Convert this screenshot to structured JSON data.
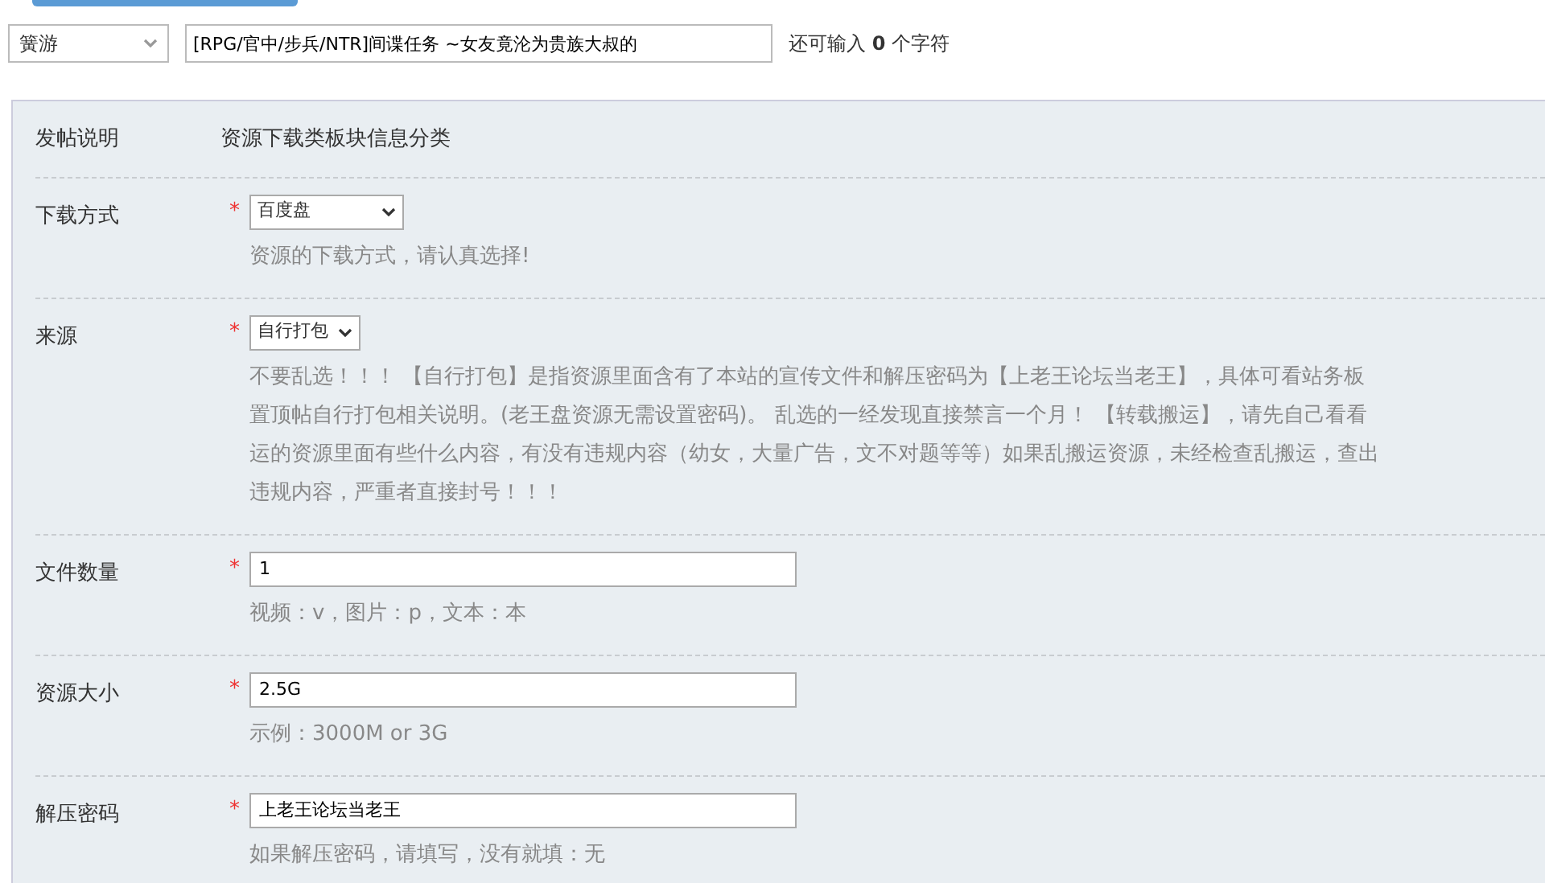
{
  "header": {
    "category_select": {
      "value": "簧游"
    },
    "title_input": {
      "value": "[RPG/官中/步兵/NTR]间谍任务 ~女友竟沦为贵族大叔的"
    },
    "char_counter": "还可输入 **0** 个字符"
  },
  "rows": [
    {
      "kind": "text",
      "label": "发帖说明",
      "value": "资源下载类板块信息分类"
    },
    {
      "kind": "select",
      "label": "下载方式",
      "required_mark": "*",
      "value": "百度盘",
      "hint_lines": [
        "资源的下载方式，请认真选择!"
      ]
    },
    {
      "kind": "select",
      "label": "来源",
      "required_mark": "*",
      "value": "自行打包",
      "hint_lines": [
        "不要乱选！！！ 【自行打包】是指资源里面含有了本站的宣传文件和解压密码为【上老王论坛当老王】，具体可看站务板",
        "置顶帖自行打包相关说明。(老王盘资源无需设置密码)。 乱选的一经发现直接禁言一个月！ 【转载搬运】，请先自己看看",
        "运的资源里面有些什么内容，有没有违规内容（幼女，大量广告，文不对题等等）如果乱搬运资源，未经检查乱搬运，查出",
        "违规内容，严重者直接封号！！！"
      ]
    },
    {
      "kind": "input",
      "label": "文件数量",
      "required_mark": "*",
      "value": "1",
      "hint_lines": [
        "视频：v，图片：p，文本：本"
      ]
    },
    {
      "kind": "input",
      "label": "资源大小",
      "required_mark": "*",
      "value": "2.5G",
      "hint_lines": [
        "示例：3000M or 3G"
      ]
    },
    {
      "kind": "input",
      "label": "解压密码",
      "required_mark": "*",
      "value": "上老王论坛当老王",
      "hint_lines": [
        "如果解压密码，请填写，没有就填：无"
      ]
    }
  ]
}
